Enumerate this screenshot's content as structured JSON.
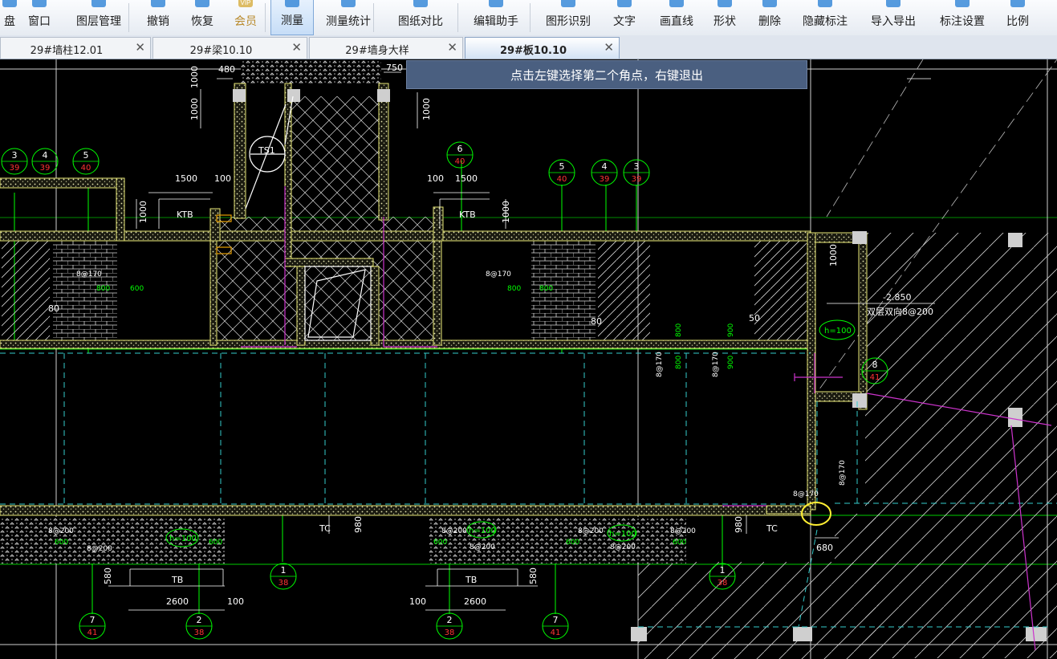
{
  "toolbar": {
    "items": [
      {
        "label": "盘",
        "icon": "disk-icon"
      },
      {
        "label": "窗口",
        "icon": "window-icon"
      },
      {
        "label": "图层管理",
        "icon": "layers-icon"
      },
      {
        "label": "撤销",
        "icon": "undo-icon"
      },
      {
        "label": "恢复",
        "icon": "redo-icon"
      },
      {
        "label": "会员",
        "icon": "vip-icon"
      },
      {
        "label": "测量",
        "icon": "ruler-icon"
      },
      {
        "label": "测量统计",
        "icon": "measure-stats-icon"
      },
      {
        "label": "图纸对比",
        "icon": "compare-icon"
      },
      {
        "label": "编辑助手",
        "icon": "edit-assistant-icon"
      },
      {
        "label": "图形识别",
        "icon": "shape-recognition-icon"
      },
      {
        "label": "文字",
        "icon": "text-icon"
      },
      {
        "label": "画直线",
        "icon": "line-icon"
      },
      {
        "label": "形状",
        "icon": "shape-icon"
      },
      {
        "label": "删除",
        "icon": "eraser-icon"
      },
      {
        "label": "隐藏标注",
        "icon": "hide-annotation-icon"
      },
      {
        "label": "导入导出",
        "icon": "import-export-icon"
      },
      {
        "label": "标注设置",
        "icon": "annotation-settings-icon"
      },
      {
        "label": "比例",
        "icon": "scale-icon"
      }
    ],
    "vip_badge": "VIP"
  },
  "tabs": [
    {
      "label": "29#墙柱12.01",
      "close": "✕"
    },
    {
      "label": "29#梁10.10",
      "close": "✕"
    },
    {
      "label": "29#墙身大样",
      "close": "✕"
    },
    {
      "label": "29#板10.10",
      "close": "✕"
    }
  ],
  "hint": "点击左键选择第二个角点，右键退出",
  "drawing": {
    "dims": {
      "d480": "480",
      "d750": "750",
      "d1000": "1000",
      "d1500": "1500",
      "d100": "100",
      "d600": "600",
      "d800": "800",
      "d900": "900",
      "d980": "980",
      "d50": "50",
      "d580": "580",
      "d2600": "2600",
      "d680": "680",
      "d80": "80"
    },
    "labels": {
      "ktb": "KTB",
      "tc": "TC",
      "tb": "TB",
      "ts1": "TS1",
      "h100": "h=100",
      "rebar170": "8@170",
      "rebar200": "8@200",
      "slab_elev": "-2.850",
      "slab_rebar": "双层双向8@200"
    },
    "axis_bubbles": [
      {
        "num": "3",
        "sub": "39"
      },
      {
        "num": "4",
        "sub": "39"
      },
      {
        "num": "5",
        "sub": "40"
      },
      {
        "num": "6",
        "sub": "40"
      },
      {
        "num": "5",
        "sub": "40"
      },
      {
        "num": "4",
        "sub": "39"
      },
      {
        "num": "3",
        "sub": "39"
      },
      {
        "num": "8",
        "sub": "41"
      },
      {
        "num": "1",
        "sub": "38"
      },
      {
        "num": "1",
        "sub": "38"
      },
      {
        "num": "7",
        "sub": "41"
      },
      {
        "num": "2",
        "sub": "38"
      },
      {
        "num": "2",
        "sub": "38"
      },
      {
        "num": "7",
        "sub": "41"
      }
    ]
  },
  "colors": {
    "background": "#000000",
    "wall_outline": "#e8e878",
    "axis_line": "#00ff00",
    "dimension_text": "#ffffff",
    "green_text": "#00ff00",
    "magenta": "#cc33cc",
    "cyan_dashed": "#33cccc",
    "red_text": "#ff3333",
    "highlight_circle": "#ffff33",
    "hint_bg": "#4a5f80"
  }
}
